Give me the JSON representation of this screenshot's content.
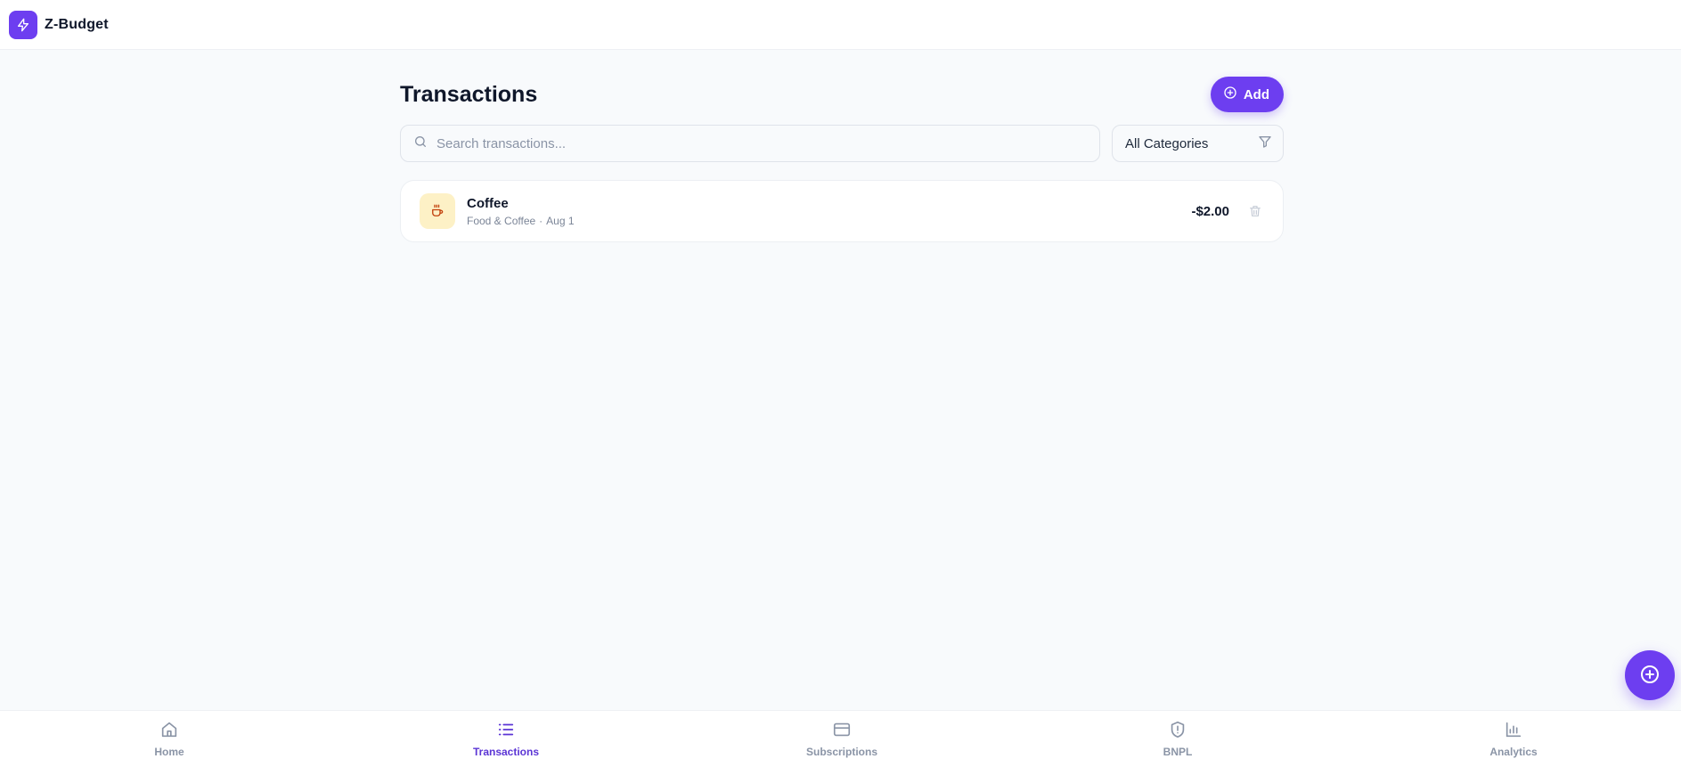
{
  "app": {
    "name": "Z-Budget",
    "accent_color": "#6d3ef0"
  },
  "header": {
    "logo_icon": "lightning-bolt-icon"
  },
  "page": {
    "title": "Transactions",
    "add_button_label": "Add"
  },
  "filters": {
    "search_placeholder": "Search transactions...",
    "search_value": "",
    "category_selected": "All Categories"
  },
  "transactions": [
    {
      "name": "Coffee",
      "category": "Food & Coffee",
      "date": "Aug 1",
      "separator": "·",
      "amount": "-$2.00",
      "icon": "coffee-cup-icon",
      "icon_bg": "#fdf1c6"
    }
  ],
  "bottom_nav": [
    {
      "label": "Home",
      "icon": "home-icon",
      "active": false
    },
    {
      "label": "Transactions",
      "icon": "list-icon",
      "active": true
    },
    {
      "label": "Subscriptions",
      "icon": "credit-card-icon",
      "active": false
    },
    {
      "label": "BNPL",
      "icon": "shield-alert-icon",
      "active": false
    },
    {
      "label": "Analytics",
      "icon": "bar-chart-icon",
      "active": false
    }
  ]
}
